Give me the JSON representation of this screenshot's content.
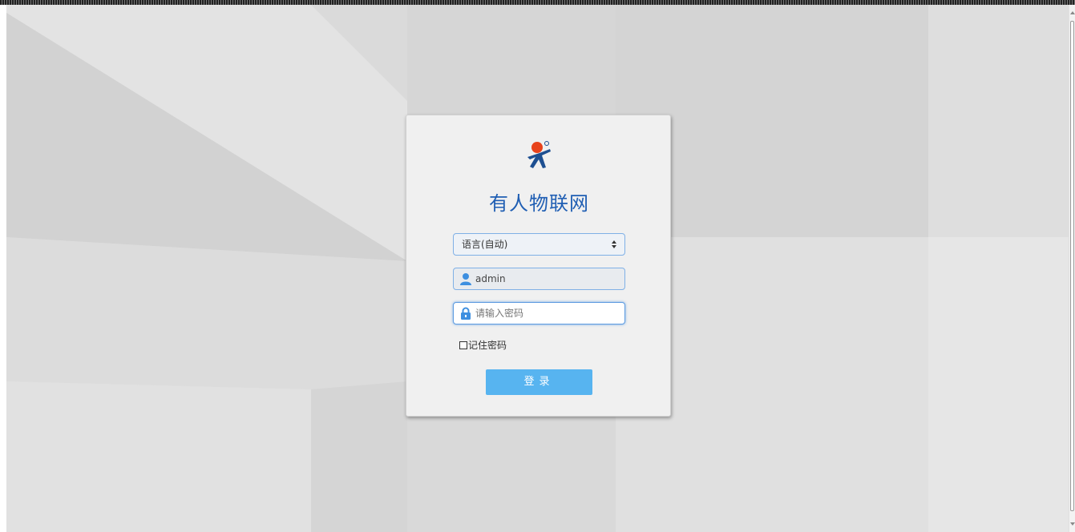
{
  "brand": {
    "title": "有人物联网",
    "logo": "usr-runner-logo"
  },
  "language_select": {
    "selected": "语言(自动)"
  },
  "username_field": {
    "value": "admin",
    "icon": "user-icon"
  },
  "password_field": {
    "placeholder": "请输入密码",
    "icon": "lock-icon"
  },
  "remember": {
    "label": "记住密码",
    "checked": false
  },
  "login_button": {
    "label": "登录"
  },
  "colors": {
    "accent": "#57b4f0",
    "brand_text": "#1f5eb3",
    "logo_red": "#e8431c",
    "logo_blue": "#1d4f91",
    "background": "#d9d9d9"
  }
}
